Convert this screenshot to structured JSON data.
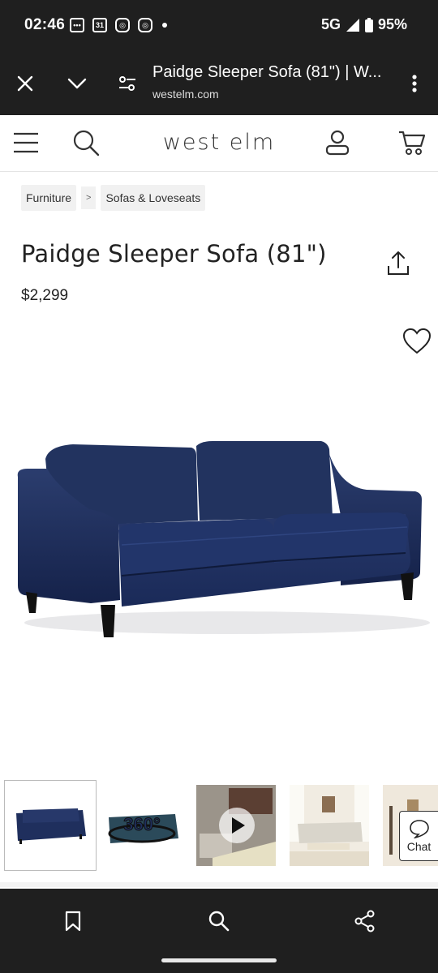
{
  "status_bar": {
    "time": "02:46",
    "calendar_day": "31",
    "network": "5G",
    "battery": "95%"
  },
  "browser": {
    "page_title": "Paidge Sleeper Sofa (81\") | W...",
    "domain": "westelm.com"
  },
  "site": {
    "logo": "west elm"
  },
  "breadcrumb": {
    "items": [
      "Furniture",
      "Sofas & Loveseats"
    ],
    "separator": ">"
  },
  "product": {
    "title": "Paidge Sleeper Sofa (81\")",
    "price": "$2,299",
    "color": "#1e2f5c"
  },
  "thumbnails": {
    "badge_360": "360°"
  },
  "chat": {
    "label": "Chat"
  }
}
